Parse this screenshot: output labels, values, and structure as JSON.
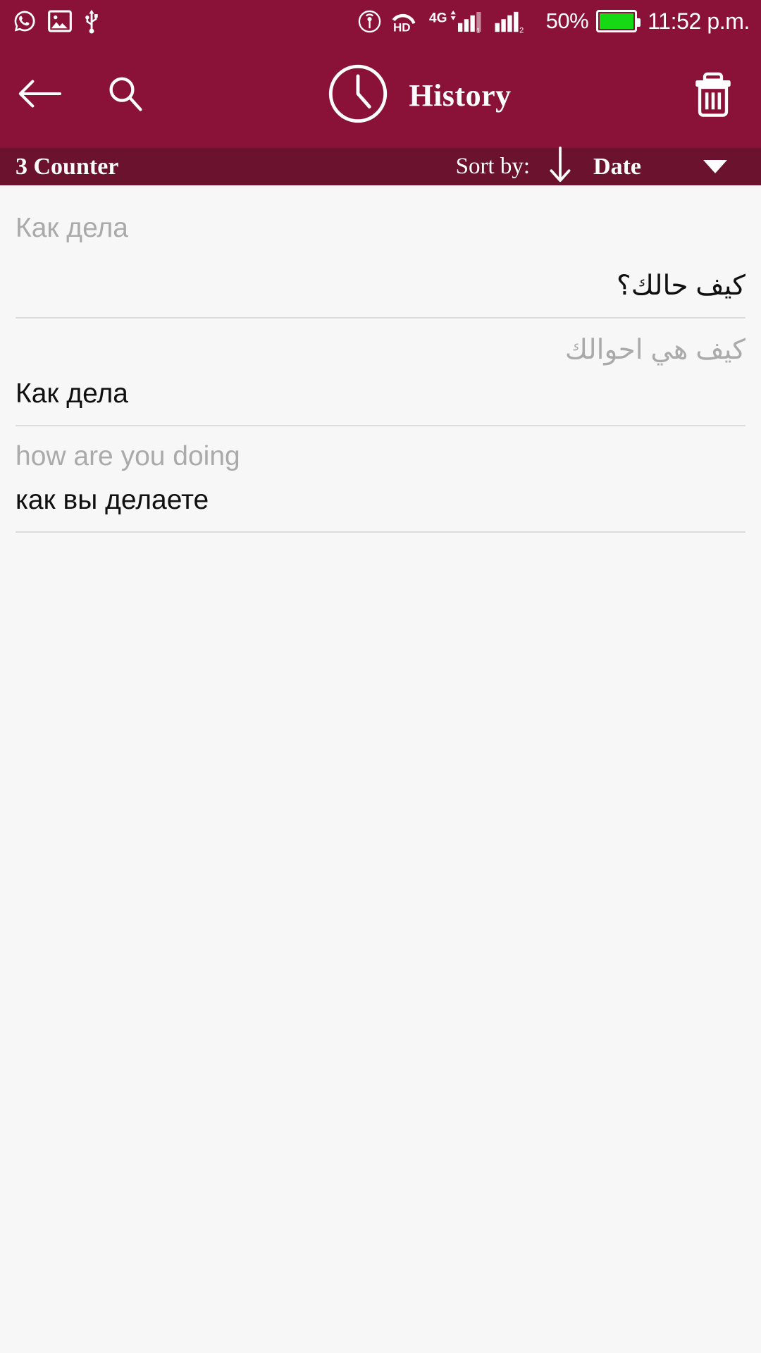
{
  "status_bar": {
    "left_icons": [
      "whatsapp-icon",
      "screenshot-image-icon",
      "usb-icon"
    ],
    "right_icons": [
      "hotspot-icon",
      "volte-hd-icon",
      "4g-signal-icon",
      "signal-bars-icon"
    ],
    "volte_label": "HD",
    "network_label": "4G",
    "battery_percent": "50%",
    "time": "11:52 p.m.",
    "battery_color": "#16d914",
    "background_color": "#8a1138"
  },
  "app_bar": {
    "background_color": "#8a1138",
    "back_label": "Back",
    "search_label": "Search",
    "clock_icon": "clock-icon",
    "title": "History",
    "delete_label": "Delete all"
  },
  "sort_bar": {
    "background_color": "#6b122f",
    "counter_text": "3 Counter",
    "sort_by_label": "Sort by:",
    "sort_direction_icon": "arrow-down-icon",
    "sort_value": "Date",
    "dropdown_icon": "caret-down-icon"
  },
  "history": {
    "source_color": "#aaaaaa",
    "target_color": "#101010",
    "items": [
      {
        "source_text": "Как дела",
        "source_dir": "ltr",
        "target_text": "كيف حالك؟",
        "target_dir": "rtl"
      },
      {
        "source_text": "كيف هي احوالك",
        "source_dir": "rtl",
        "target_text": "Как дела",
        "target_dir": "ltr"
      },
      {
        "source_text": "how are you doing",
        "source_dir": "ltr",
        "target_text": "как вы делаете",
        "target_dir": "ltr"
      }
    ]
  }
}
